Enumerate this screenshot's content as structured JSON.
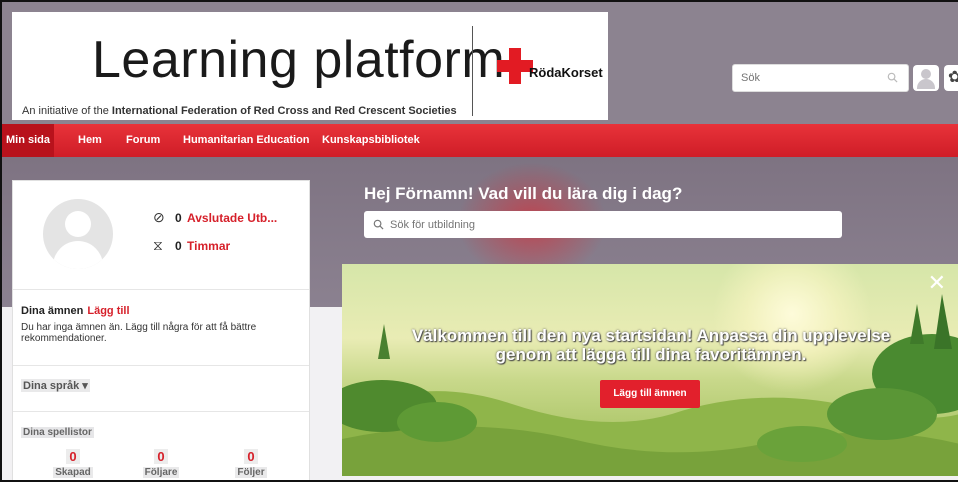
{
  "header": {
    "logo_title": "Learning platform",
    "logo_sub_prefix": "An initiative of the ",
    "logo_sub_bold": "International Federation of Red Cross and Red Crescent Societies",
    "partner_name": "RödaKorset",
    "search_placeholder": "Sök",
    "gear_glyph": "✿"
  },
  "nav": {
    "items": [
      {
        "label": "Min sida"
      },
      {
        "label": "Hem"
      },
      {
        "label": "Forum"
      },
      {
        "label": "Humanitarian Education"
      },
      {
        "label": "Kunskapsbibliotek"
      }
    ]
  },
  "hero": {
    "title": "Hej Förnamn! Vad vill du lära dig i dag?",
    "search_placeholder": "Sök för utbildning"
  },
  "profile": {
    "completed_count": "0",
    "completed_label": "Avslutade Utb...",
    "hours_count": "0",
    "hours_label": "Timmar",
    "topics_heading": "Dina ämnen",
    "topics_add": "Lägg till",
    "topics_text": "Du har inga ämnen än. Lägg till några för att få bättre rekommendationer.",
    "languages_label": "Dina språk ▾",
    "playlists_heading": "Dina spellistor",
    "playlist_stats": [
      {
        "value": "0",
        "label": "Skapad"
      },
      {
        "value": "0",
        "label": "Följare"
      },
      {
        "value": "0",
        "label": "Följer"
      }
    ]
  },
  "welcome": {
    "line1": "Välkommen till den nya startsidan! Anpassa din upplevelse",
    "line2": "genom att lägga till dina favoritämnen.",
    "button_label": "Lägg till ämnen",
    "close_glyph": "✕"
  },
  "colors": {
    "accent_red": "#d6202a",
    "header_gray": "#8c8390"
  }
}
